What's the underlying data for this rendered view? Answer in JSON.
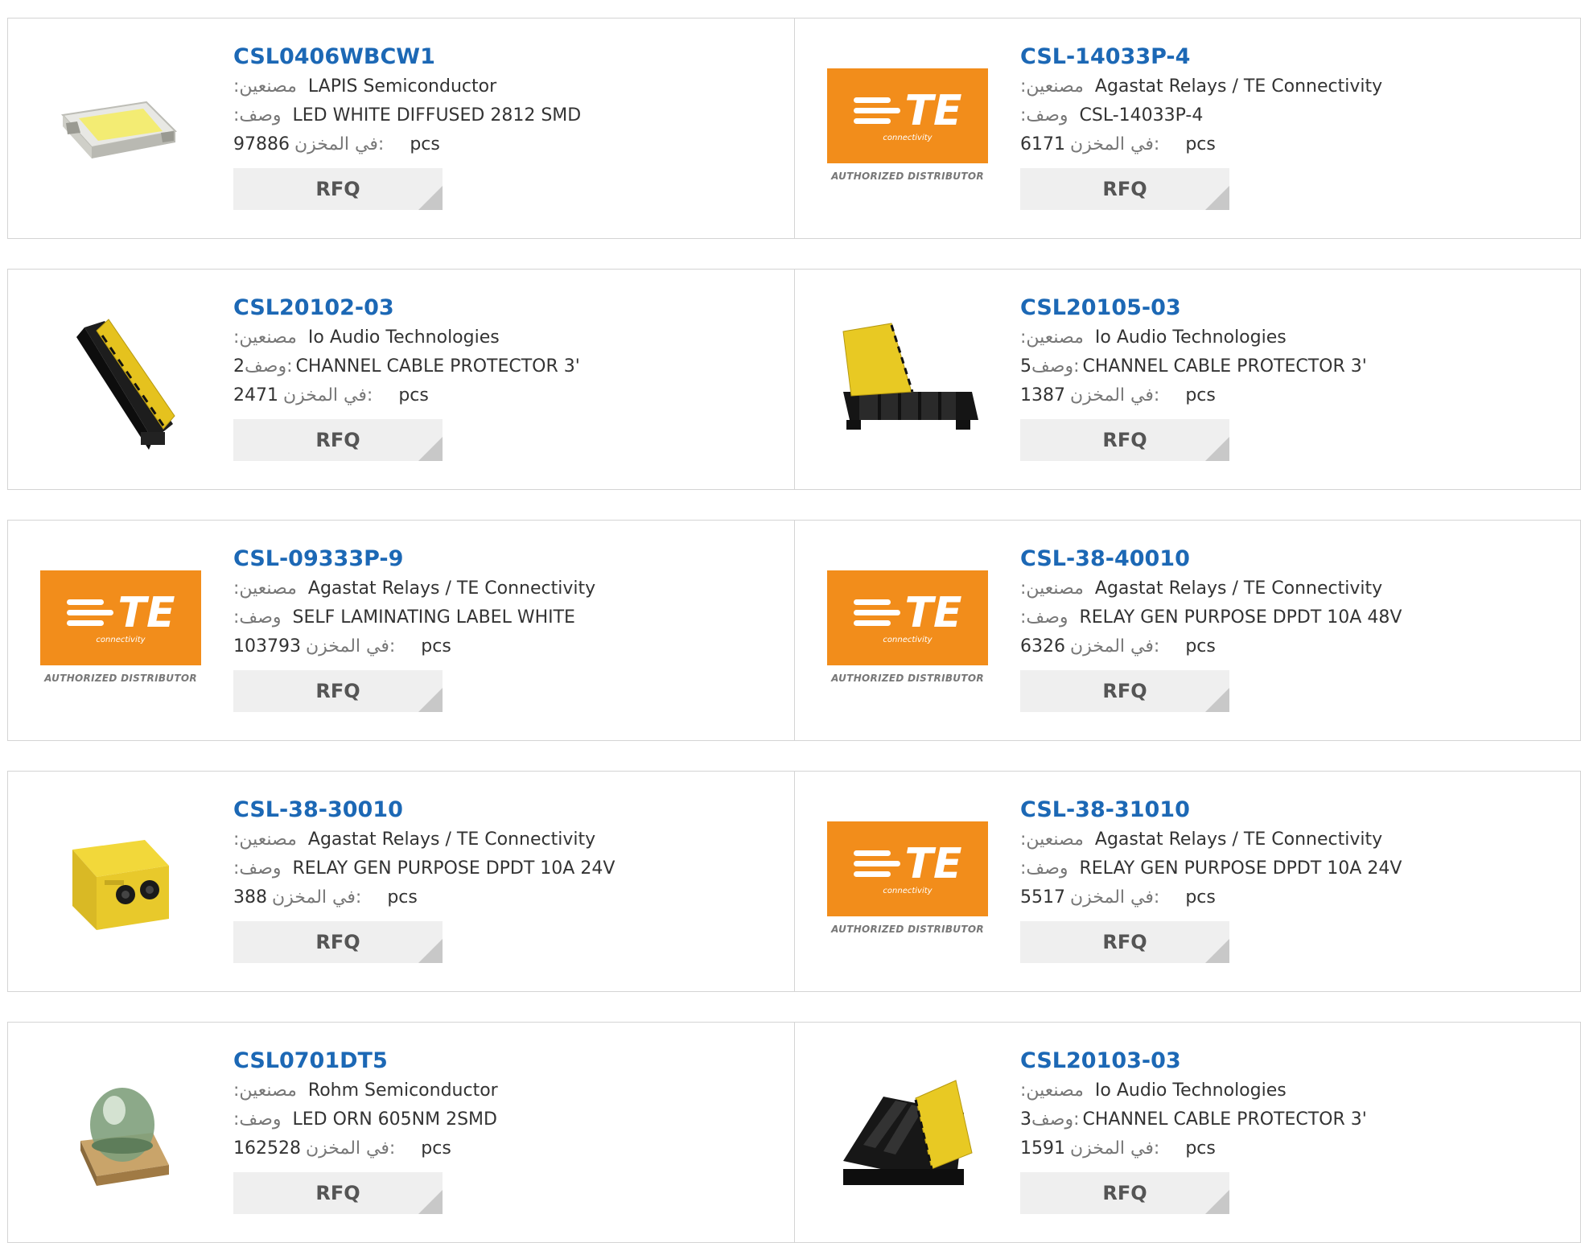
{
  "labels": {
    "manufacturer": ":مصنعين",
    "description": ":وصف",
    "description_alt": "وصف:",
    "stock": "في المخزن:",
    "unit": "pcs",
    "rfq": "RFQ"
  },
  "logo": {
    "brand": "TE",
    "sub": "connectivity",
    "authorized": "AUTHORIZED DISTRIBUTOR"
  },
  "products": [
    {
      "pn": "CSL0406WBCW1",
      "manufacturer": "LAPIS Semiconductor",
      "description": "LED WHITE DIFFUSED 2812 SMD",
      "stock": "97886"
    },
    {
      "pn": "CSL-14033P-4",
      "manufacturer": "Agastat Relays / TE Connectivity",
      "description": "CSL-14033P-4",
      "stock": "6171"
    },
    {
      "pn": "CSL20102-03",
      "manufacturer": "Io Audio Technologies",
      "description": "CHANNEL CABLE PROTECTOR 3'",
      "description_num": "2",
      "stock": "2471"
    },
    {
      "pn": "CSL20105-03",
      "manufacturer": "Io Audio Technologies",
      "description": "CHANNEL CABLE PROTECTOR 3'",
      "description_num": "5",
      "stock": "1387"
    },
    {
      "pn": "CSL-09333P-9",
      "manufacturer": "Agastat Relays / TE Connectivity",
      "description": "SELF LAMINATING LABEL WHITE",
      "stock": "103793"
    },
    {
      "pn": "CSL-38-40010",
      "manufacturer": "Agastat Relays / TE Connectivity",
      "description": "RELAY GEN PURPOSE DPDT 10A 48V",
      "stock": "6326"
    },
    {
      "pn": "CSL-38-30010",
      "manufacturer": "Agastat Relays / TE Connectivity",
      "description": "RELAY GEN PURPOSE DPDT 10A 24V",
      "stock": "388"
    },
    {
      "pn": "CSL-38-31010",
      "manufacturer": "Agastat Relays / TE Connectivity",
      "description": "RELAY GEN PURPOSE DPDT 10A 24V",
      "stock": "5517"
    },
    {
      "pn": "CSL0701DT5",
      "manufacturer": "Rohm Semiconductor",
      "description": "LED ORN 605NM 2SMD",
      "stock": "162528"
    },
    {
      "pn": "CSL20103-03",
      "manufacturer": "Io Audio Technologies",
      "description": "CHANNEL CABLE PROTECTOR 3'",
      "description_num": "3",
      "stock": "1591"
    }
  ]
}
